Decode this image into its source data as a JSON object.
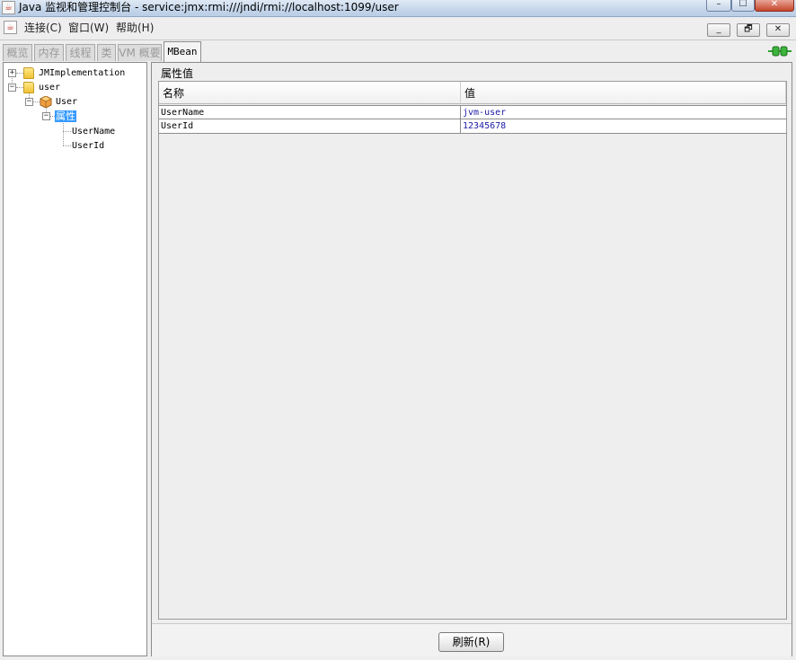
{
  "window": {
    "title": "Java 监视和管理控制台 - service:jmx:rmi:///jndi/rmi://localhost:1099/user",
    "app_icon": "java-cup-icon",
    "controls": {
      "minimize": "–",
      "maximize": "☐",
      "close": "✕"
    }
  },
  "menubar": {
    "items": [
      {
        "label": "连接(C)"
      },
      {
        "label": "窗口(W)"
      },
      {
        "label": "帮助(H)"
      }
    ],
    "inner_controls": {
      "minimize": "_",
      "restore": "🗗",
      "close": "✕"
    }
  },
  "tabs": [
    {
      "label": "概览",
      "enabled": false
    },
    {
      "label": "内存",
      "enabled": false
    },
    {
      "label": "线程",
      "enabled": false
    },
    {
      "label": "类",
      "enabled": false
    },
    {
      "label": "VM 概要",
      "enabled": false
    },
    {
      "label": "MBean",
      "enabled": true,
      "selected": true
    }
  ],
  "connection_status_icon": "connected-plug-icon",
  "tree": {
    "nodes": [
      {
        "label": "JMImplementation",
        "expander": "+",
        "icon": "folder-icon"
      },
      {
        "label": "user",
        "expander": "−",
        "icon": "folder-icon"
      },
      {
        "label": "User",
        "expander": "−",
        "icon": "mbean-bean-icon"
      },
      {
        "label": "属性",
        "expander": "−",
        "selected": true
      },
      {
        "label": "UserName"
      },
      {
        "label": "UserId"
      }
    ]
  },
  "attributes": {
    "section_title": "属性值",
    "columns": [
      "名称",
      "值"
    ],
    "rows": [
      {
        "name": "UserName",
        "value": "jvm-user"
      },
      {
        "name": "UserId",
        "value": "12345678"
      }
    ]
  },
  "actions": {
    "refresh_label": "刷新(R)"
  },
  "colors": {
    "selection": "#3399ff",
    "value_text": "#1a1aa6",
    "connection_green": "#2e9e2e"
  }
}
